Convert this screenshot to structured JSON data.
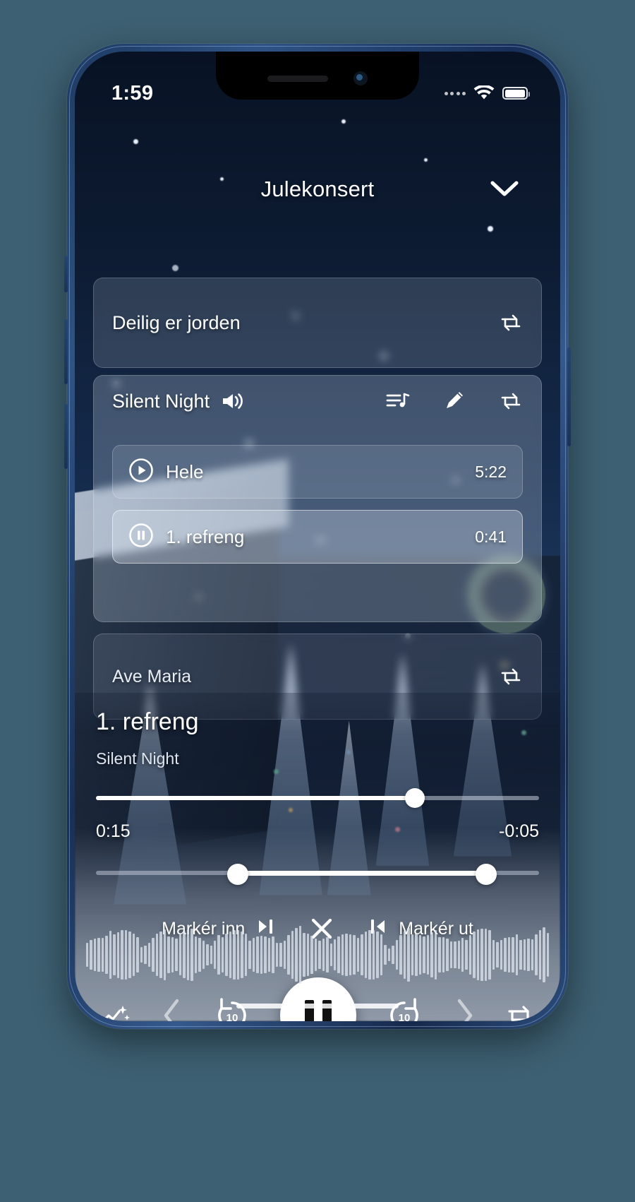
{
  "status_bar": {
    "time": "1:59",
    "signal_dots": 4,
    "wifi_icon": "wifi-icon",
    "battery_icon": "battery-icon",
    "battery_level_pct": 88
  },
  "header": {
    "title": "Julekonsert",
    "collapse_icon": "chevron-down-icon"
  },
  "song_cards": [
    {
      "title": "Deilig er jorden",
      "loop_icon": "repeat-icon",
      "expanded": false
    },
    {
      "title": "Silent Night",
      "volume_icon": "volume-icon",
      "playlist_icon": "playlist-music-icon",
      "edit_icon": "pencil-icon",
      "loop_icon": "repeat-icon",
      "expanded": true,
      "tracks": [
        {
          "name": "Hele",
          "duration": "5:22",
          "state_icon": "play-circle-icon",
          "active": false
        },
        {
          "name": "1. refreng",
          "duration": "0:41",
          "state_icon": "pause-circle-icon",
          "active": true
        }
      ]
    },
    {
      "title": "Ave Maria",
      "loop_icon": "repeat-icon",
      "expanded": false
    }
  ],
  "now_playing": {
    "title": "1. refreng",
    "subtitle": "Silent Night",
    "elapsed": "0:15",
    "remaining": "-0:05",
    "seek_percent": 72,
    "range_start_percent": 32,
    "range_end_percent": 88
  },
  "markers": {
    "mark_in_label": "Markér inn",
    "mark_in_icon": "mark-in-icon",
    "clear_icon": "close-icon",
    "mark_out_label": "Markér ut",
    "mark_out_icon": "mark-out-icon"
  },
  "transport": {
    "magic_icon": "sparkle-wave-icon",
    "previous_icon": "chevron-left-icon",
    "rewind_icon": "rewind-10-icon",
    "rewind_label": "10",
    "play_pause_icon": "pause-icon",
    "forward_icon": "forward-10-icon",
    "forward_label": "10",
    "next_icon": "chevron-right-icon",
    "repeat_icon": "repeat-icon"
  },
  "colors": {
    "accent": "#ffffff",
    "card_bg": "rgba(214,225,238,0.17)",
    "device_frame": "#2e5385"
  }
}
